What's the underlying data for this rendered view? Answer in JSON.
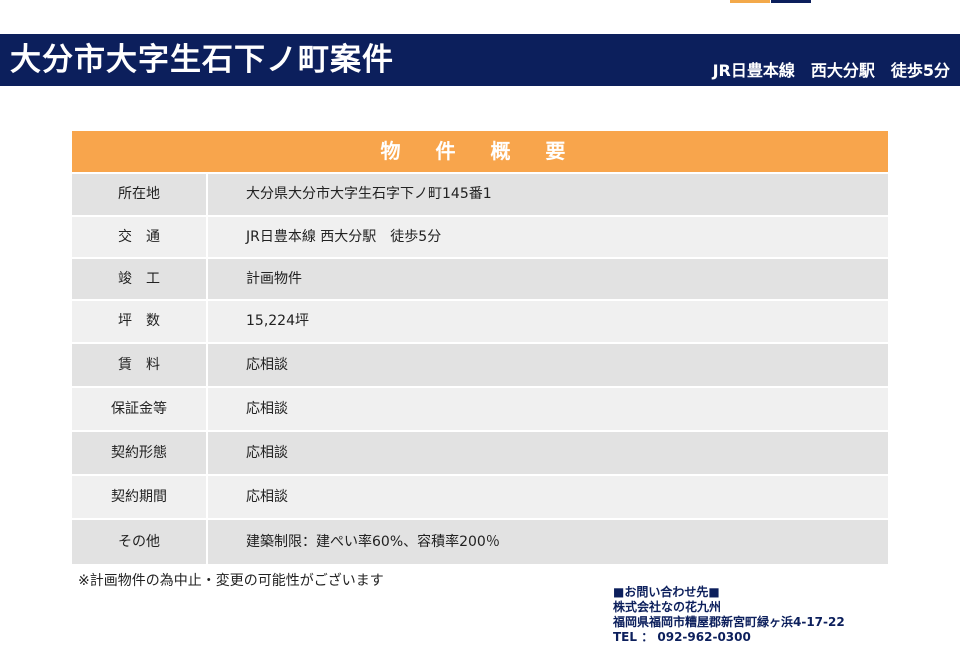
{
  "header": {
    "title": "大分市大字生石下ノ町案件",
    "access": "JR日豊本線　西大分駅　徒歩5分"
  },
  "table": {
    "heading": "物 件 概 要",
    "rows": [
      {
        "label": "所在地",
        "value": "大分県大分市大字生石字下ノ町145番1"
      },
      {
        "label": "交　通",
        "value": "JR日豊本線 西大分駅　徒歩5分"
      },
      {
        "label": "竣　工",
        "value": "計画物件"
      },
      {
        "label": "坪　数",
        "value": "15,224坪"
      },
      {
        "label": "賃　料",
        "value": "応相談"
      },
      {
        "label": "保証金等",
        "value": "応相談"
      },
      {
        "label": "契約形態",
        "value": "応相談"
      },
      {
        "label": "契約期間",
        "value": "応相談"
      },
      {
        "label": "その他",
        "value": "建築制限：建ぺい率60%、容積率200％"
      }
    ]
  },
  "note": "※計画物件の為中止・変更の可能性がございます",
  "contact": {
    "heading": "■お問い合わせ先■",
    "company": "株式会社なの花九州",
    "address": "福岡県福岡市糟屋郡新宮町緑ヶ浜4-17-22",
    "tel": "TEL ： 092-962-0300"
  },
  "colors": {
    "navy": "#0c1f5c",
    "orange": "#f8a54c",
    "row_dark": "#e2e2e2",
    "row_light": "#f0f0f0"
  }
}
